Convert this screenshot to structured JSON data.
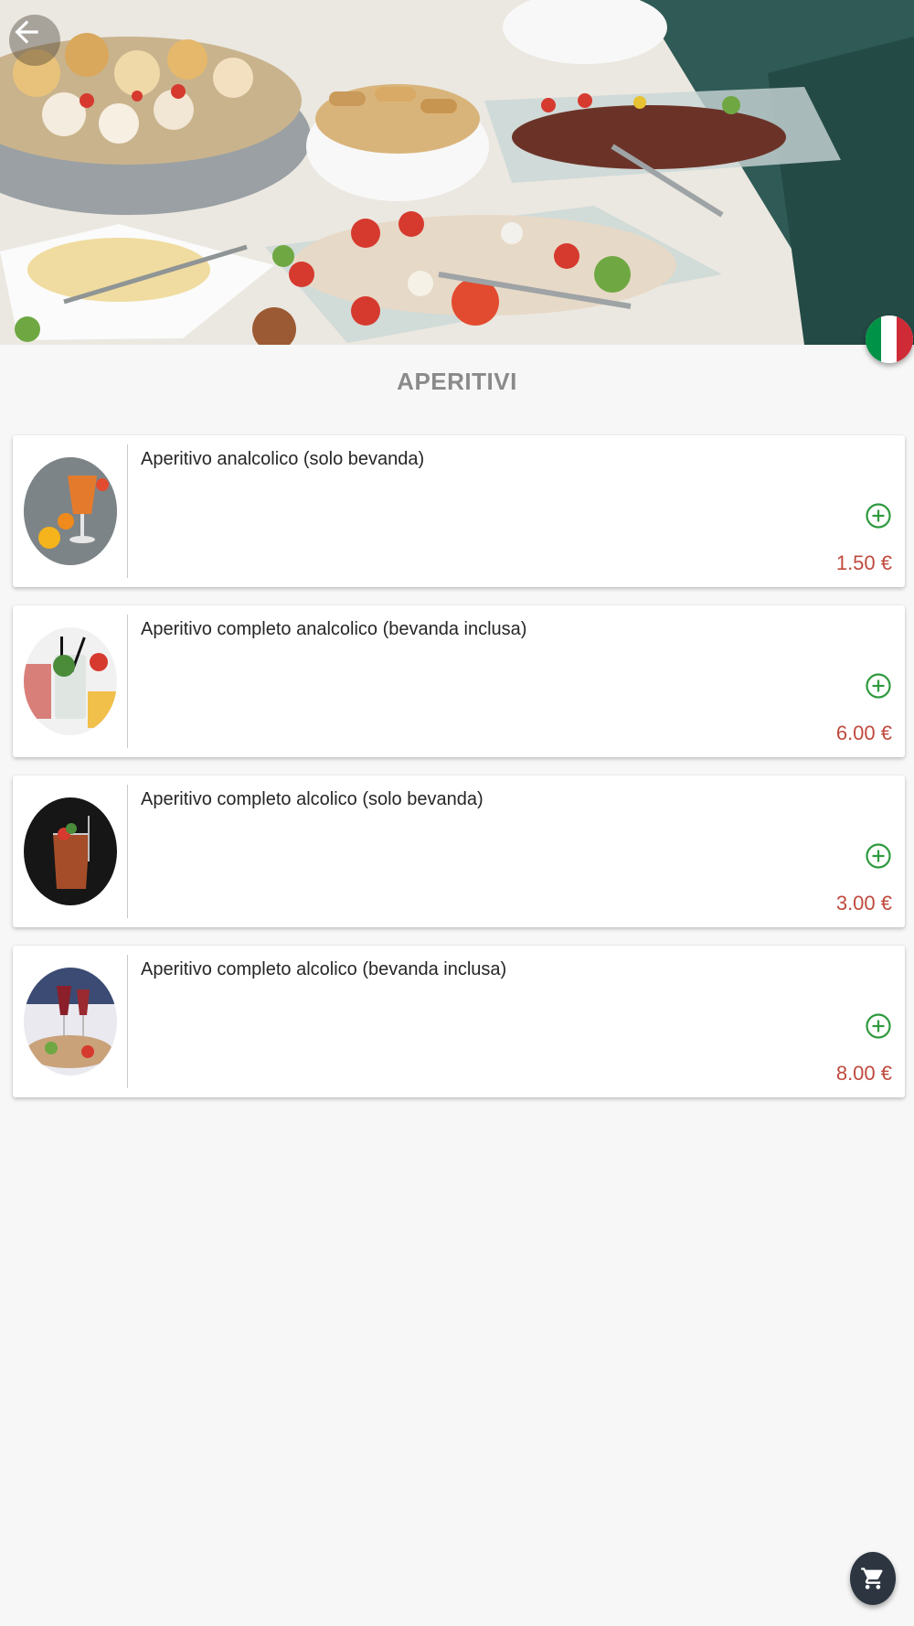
{
  "header": {
    "back_icon": "arrow-left-icon",
    "language_icon": "italian-flag-icon",
    "hero_image": "aperitivo-buffet-photo"
  },
  "section": {
    "title": "APERITIVI"
  },
  "menu": {
    "items": [
      {
        "name": "Aperitivo analcolico (solo bevanda)",
        "price": "1.50 €",
        "image": "orange-spritz-photo",
        "add_icon": "plus-circle-icon"
      },
      {
        "name": "Aperitivo completo analcolico (bevanda inclusa)",
        "price": "6.00 €",
        "image": "drink-and-snacks-photo",
        "add_icon": "plus-circle-icon"
      },
      {
        "name": "Aperitivo completo alcolico (solo bevanda)",
        "price": "3.00 €",
        "image": "cocktail-glass-photo",
        "add_icon": "plus-circle-icon"
      },
      {
        "name": "Aperitivo completo alcolico (bevanda inclusa)",
        "price": "8.00 €",
        "image": "wine-glasses-buffet-photo",
        "add_icon": "plus-circle-icon"
      }
    ]
  },
  "cart": {
    "icon": "cart-icon"
  },
  "colors": {
    "price": "#c04a3e",
    "add_icon": "#2e9a3e",
    "title": "#8a8a8a",
    "cart_bg": "#2c3540",
    "flag_green": "#009246",
    "flag_white": "#ffffff",
    "flag_red": "#ce2b37"
  }
}
